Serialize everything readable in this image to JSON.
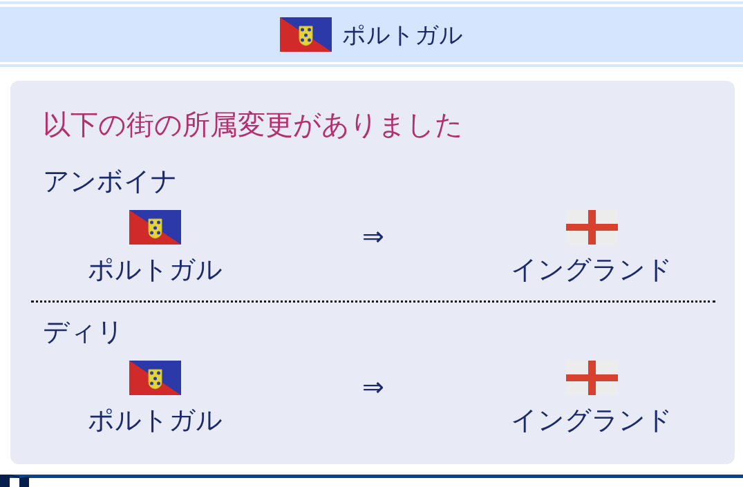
{
  "header": {
    "nation": {
      "kind": "portugal",
      "name": "ポルトガル"
    }
  },
  "notice": {
    "title": "以下の街の所属変更がありました",
    "changes": [
      {
        "city": "アンボイナ",
        "from": {
          "kind": "portugal",
          "name": "ポルトガル"
        },
        "arrow": "⇒",
        "to": {
          "kind": "england",
          "name": "イングランド"
        }
      },
      {
        "city": "ディリ",
        "from": {
          "kind": "portugal",
          "name": "ポルトガル"
        },
        "arrow": "⇒",
        "to": {
          "kind": "england",
          "name": "イングランド"
        }
      }
    ]
  }
}
